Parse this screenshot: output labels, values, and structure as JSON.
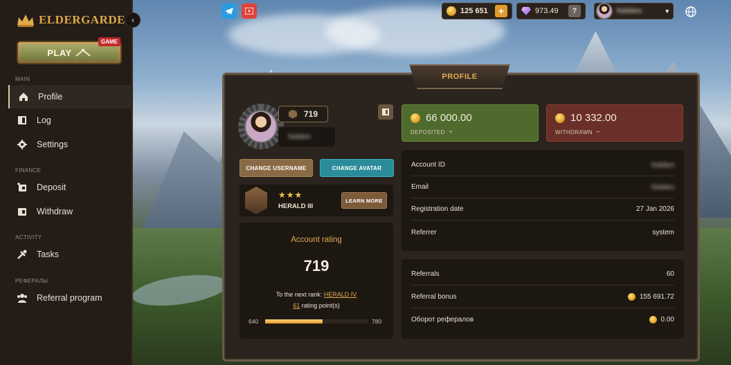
{
  "brand": {
    "name": "ELDERGARDE"
  },
  "sidebar": {
    "play_label": "PLAY",
    "game_badge": "GAME",
    "sections": [
      {
        "title": "MAIN",
        "items": [
          {
            "label": "Profile",
            "icon": "home-icon",
            "active": true
          },
          {
            "label": "Log",
            "icon": "book-icon"
          },
          {
            "label": "Settings",
            "icon": "gear-icon"
          }
        ]
      },
      {
        "title": "FINANCE",
        "items": [
          {
            "label": "Deposit",
            "icon": "wallet-plus-icon"
          },
          {
            "label": "Withdraw",
            "icon": "wallet-icon"
          }
        ]
      },
      {
        "title": "ACTIVITY",
        "items": [
          {
            "label": "Tasks",
            "icon": "tasks-icon"
          }
        ]
      },
      {
        "title": "РЕФЕРАЛЫ",
        "items": [
          {
            "label": "Referral program",
            "icon": "users-icon"
          }
        ]
      }
    ]
  },
  "topbar": {
    "coins": "125 651",
    "gems": "973.49",
    "username": "hidden"
  },
  "profile": {
    "title": "PROFILE",
    "rating_badge": "719",
    "change_username": "CHANGE USERNAME",
    "change_avatar": "CHANGE AVATAR",
    "rank": {
      "stars": "★★★",
      "name": "HERALD III",
      "learn_more": "LEARN MORE"
    },
    "account_rating": {
      "title": "Account rating",
      "value": "719",
      "next_prefix": "To the next rank:",
      "next_rank": "HERALD IV",
      "points_value": "61",
      "points_suffix": "rating point(s)",
      "min": "640",
      "max": "780",
      "progress": 0.56
    },
    "deposited": {
      "amount": "66 000.00",
      "label": "DEPOSITED",
      "sign": "+"
    },
    "withdrawn": {
      "amount": "10 332.00",
      "label": "WITHDRAWN",
      "sign": "−"
    },
    "account": {
      "id_label": "Account ID",
      "id_value": "hidden",
      "email_label": "Email",
      "email_value": "hidden",
      "registration_label": "Registration date",
      "registration_value": "27 Jan 2026",
      "referrer_label": "Referrer",
      "referrer_value": "system"
    },
    "referrals": {
      "count_label": "Referrals",
      "count_value": "60",
      "bonus_label": "Referral bonus",
      "bonus_value": "155 691.72",
      "turnover_label": "Оборот рефералов",
      "turnover_value": "0.00"
    }
  },
  "colors": {
    "accent": "#e3ad52",
    "deposit_bg": "#4e6a2c",
    "withdraw_bg": "#6a2f28",
    "teal": "#2a8c98"
  }
}
